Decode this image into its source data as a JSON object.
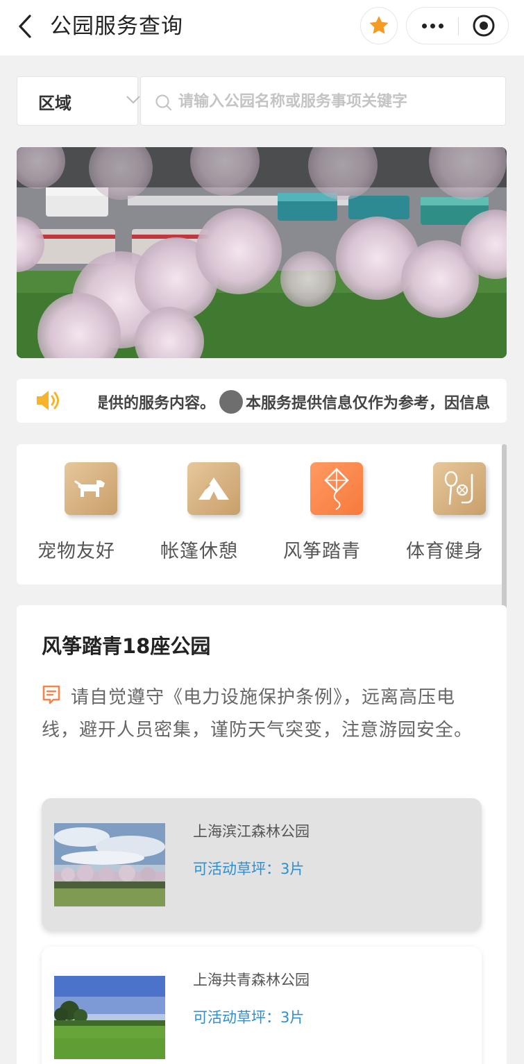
{
  "nav": {
    "title": "公园服务查询",
    "back_icon": "chevron-left-icon",
    "favorite_icon": "star-icon",
    "favorite_color": "#f59a23",
    "more_icon": "more-dots-icon",
    "close_icon": "target-circle-icon"
  },
  "search": {
    "region_label": "区域",
    "placeholder": "请输入公园名称或服务事项关键字"
  },
  "notice": {
    "text_before": "提供的服务内容。",
    "text_after": "本服务提供信息仅作为参考，因信息"
  },
  "categories": [
    {
      "label": "宠物友好",
      "icon": "dog-icon",
      "style": "gold"
    },
    {
      "label": "帐篷休憩",
      "icon": "tent-icon",
      "style": "gold"
    },
    {
      "label": "风筝踏青",
      "icon": "kite-icon",
      "style": "orange"
    },
    {
      "label": "体育健身",
      "icon": "sports-icon",
      "style": "gold"
    }
  ],
  "section": {
    "title": "风筝踏青18座公园",
    "tip": "请自觉遵守《电力设施保护条例》，远离高压电线，避开人员密集，谨防天气突变，注意游园安全。",
    "parks": [
      {
        "name": "上海滨江森林公园",
        "lawns": "可活动草坪：3片"
      },
      {
        "name": "上海共青森林公园",
        "lawns": "可活动草坪：3片"
      }
    ]
  },
  "colors": {
    "accent_orange": "#f77a3b",
    "gold_tile": "#c89f6a",
    "lawn_text_blue": "#2e8fd0"
  }
}
